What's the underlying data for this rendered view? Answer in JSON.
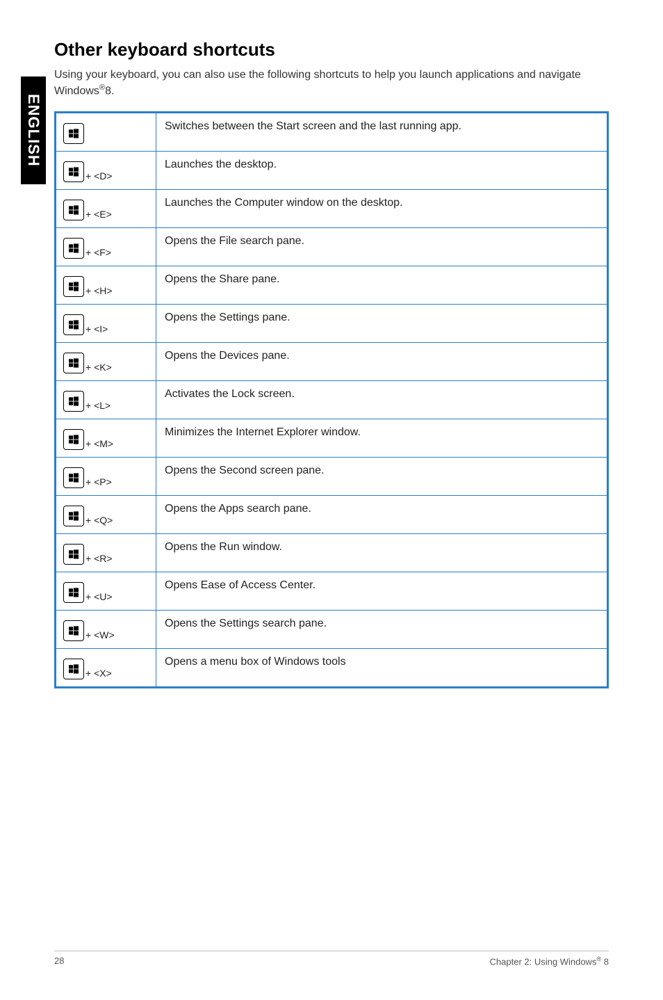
{
  "sideTab": "ENGLISH",
  "heading": "Other keyboard shortcuts",
  "intro_pre": "Using your keyboard, you can also use the following shortcuts to help you launch applications and navigate Windows",
  "intro_sup": "®",
  "intro_post": "8.",
  "rows": [
    {
      "key": "",
      "desc": "Switches between the Start screen and the last running app.",
      "cls": "short"
    },
    {
      "key": "+ <D>",
      "desc": "Launches the desktop.",
      "cls": "med"
    },
    {
      "key": "+ <E>",
      "desc": "Launches the Computer window on the desktop.",
      "cls": "tall"
    },
    {
      "key": "+ <F>",
      "desc": "Opens the File search pane.",
      "cls": "med"
    },
    {
      "key": "+ <H>",
      "desc": "Opens the Share pane.",
      "cls": "short"
    },
    {
      "key": "+ <I>",
      "desc": "Opens the Settings pane.",
      "cls": "med"
    },
    {
      "key": "+ <K>",
      "desc": "Opens the Devices pane.",
      "cls": "med"
    },
    {
      "key": "+ <L>",
      "desc": "Activates the Lock screen.",
      "cls": "med"
    },
    {
      "key": "+ <M>",
      "desc": "Minimizes the Internet Explorer window.",
      "cls": "med"
    },
    {
      "key": "+ <P>",
      "desc": "Opens the Second screen pane.",
      "cls": "med"
    },
    {
      "key": "+ <Q>",
      "desc": "Opens the Apps search pane.",
      "cls": "tall"
    },
    {
      "key": "+ <R>",
      "desc": "Opens the Run window.",
      "cls": "med"
    },
    {
      "key": "+ <U>",
      "desc": "Opens Ease of Access Center.",
      "cls": "med"
    },
    {
      "key": "+ <W>",
      "desc": "Opens the Settings search pane.",
      "cls": "med"
    },
    {
      "key": "+ <X>",
      "desc": "Opens a menu box of Windows tools",
      "cls": "med"
    }
  ],
  "footer": {
    "pageNum": "28",
    "chapter_pre": "Chapter 2: Using Windows",
    "chapter_sup": "®",
    "chapter_post": " 8"
  }
}
